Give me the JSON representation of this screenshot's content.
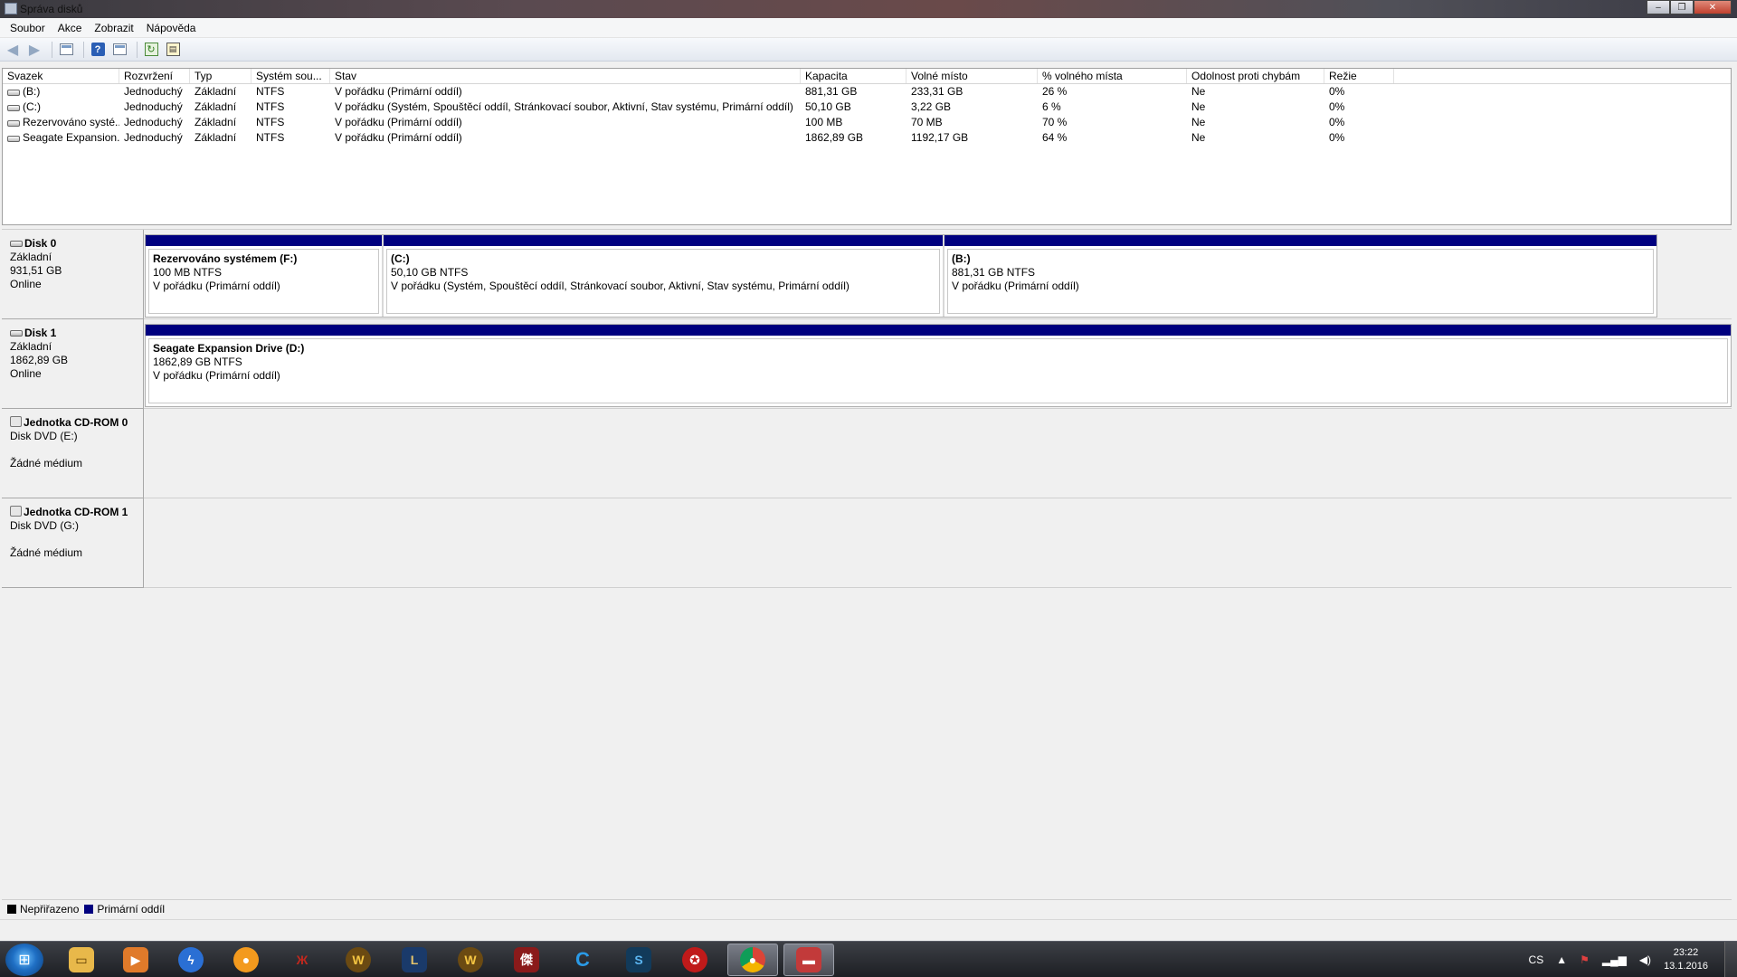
{
  "window": {
    "title": "Správa disků"
  },
  "menu": [
    "Soubor",
    "Akce",
    "Zobrazit",
    "Nápověda"
  ],
  "toolbar": {
    "back_icon": "back-arrow-icon",
    "forward_icon": "forward-arrow-icon",
    "help_glyph": "?",
    "refresh_glyph": "↻",
    "props_glyph": "▤"
  },
  "volumes": {
    "columns": [
      "Svazek",
      "Rozvržení",
      "Typ",
      "Systém sou...",
      "Stav",
      "Kapacita",
      "Volné místo",
      "% volného místa",
      "Odolnost proti chybám",
      "Režie"
    ],
    "rows": [
      [
        "(B:)",
        "Jednoduchý",
        "Základní",
        "NTFS",
        "V pořádku (Primární oddíl)",
        "881,31 GB",
        "233,31 GB",
        "26 %",
        "Ne",
        "0%"
      ],
      [
        "(C:)",
        "Jednoduchý",
        "Základní",
        "NTFS",
        "V pořádku (Systém, Spouštěcí oddíl, Stránkovací soubor, Aktivní, Stav systému, Primární oddíl)",
        "50,10 GB",
        "3,22 GB",
        "6 %",
        "Ne",
        "0%"
      ],
      [
        "Rezervováno systé...",
        "Jednoduchý",
        "Základní",
        "NTFS",
        "V pořádku (Primární oddíl)",
        "100 MB",
        "70 MB",
        "70 %",
        "Ne",
        "0%"
      ],
      [
        "Seagate Expansion...",
        "Jednoduchý",
        "Základní",
        "NTFS",
        "V pořádku (Primární oddíl)",
        "1862,89 GB",
        "1192,17 GB",
        "64 %",
        "Ne",
        "0%"
      ]
    ]
  },
  "disks": [
    {
      "name": "Disk 0",
      "type": "Základní",
      "size": "931,51 GB",
      "state": "Online",
      "partitions": [
        {
          "name": "Rezervováno systémem  (F:)",
          "size": "100 MB NTFS",
          "status": "V pořádku (Primární oddíl)"
        },
        {
          "name": "(C:)",
          "size": "50,10 GB NTFS",
          "status": "V pořádku (Systém, Spouštěcí oddíl, Stránkovací soubor, Aktivní, Stav systému, Primární oddíl)"
        },
        {
          "name": "(B:)",
          "size": "881,31 GB NTFS",
          "status": "V pořádku (Primární oddíl)"
        }
      ]
    },
    {
      "name": "Disk 1",
      "type": "Základní",
      "size": "1862,89 GB",
      "state": "Online",
      "partitions": [
        {
          "name": "Seagate Expansion Drive  (D:)",
          "size": "1862,89 GB NTFS",
          "status": "V pořádku (Primární oddíl)"
        }
      ]
    },
    {
      "name": "Jednotka CD-ROM 0",
      "type": "Disk DVD (E:)",
      "state": "Žádné médium"
    },
    {
      "name": "Jednotka CD-ROM 1",
      "type": "Disk DVD (G:)",
      "state": "Žádné médium"
    }
  ],
  "legend": [
    {
      "label": "Nepřiřazeno",
      "color": "#000000"
    },
    {
      "label": "Primární oddíl",
      "color": "#00007f"
    }
  ],
  "taskbar": {
    "apps": [
      "windows-explorer",
      "media-player",
      "lightning-app",
      "orange-app",
      "raid-app",
      "wow-app",
      "league-app",
      "wow-app-2",
      "game-app",
      "ccleaner-app",
      "starcraft-app",
      "raidcall-app",
      "chrome",
      "disk-management"
    ],
    "tray": {
      "language": "CS",
      "time": "23:22",
      "date": "13.1.2016"
    }
  },
  "colors": {
    "primary_partition": "#00007f",
    "unallocated": "#000000"
  }
}
